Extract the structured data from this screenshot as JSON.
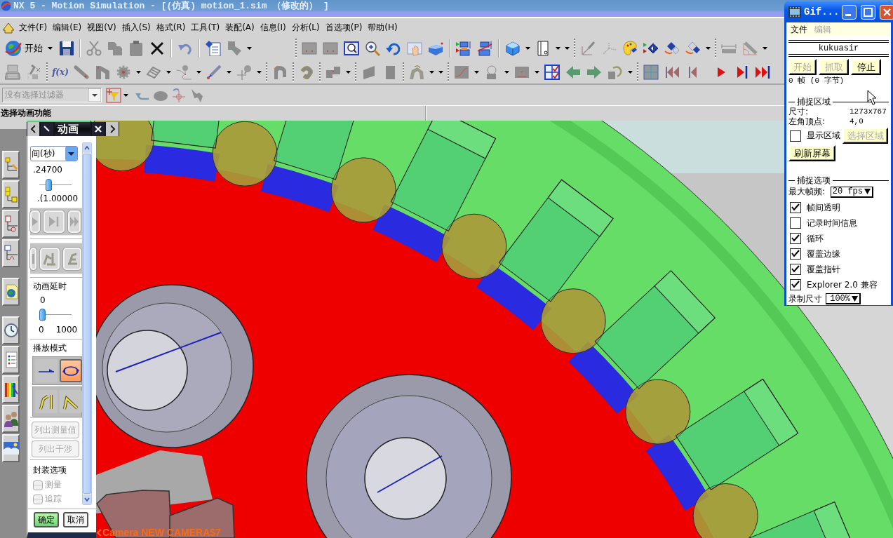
{
  "title_bar": {
    "title": "NX 5 - Motion Simulation - [(仿真) motion_1.sim （修改的） ]"
  },
  "menu_bar": {
    "items": [
      "文件(F)",
      "编辑(E)",
      "视图(V)",
      "插入(S)",
      "格式(R)",
      "工具(T)",
      "装配(A)",
      "信息(I)",
      "分析(L)",
      "首选项(P)",
      "帮助(H)"
    ]
  },
  "toolbar": {
    "start_button": "开始",
    "function_button": "f(x)"
  },
  "selection_bar": {
    "filter": {
      "value": "没有选择过滤器",
      "disabled": true
    }
  },
  "cue_line": {
    "prompt": "选择动画功能"
  },
  "animation_dialog": {
    "title": "动画",
    "time_unit": "间(秒)",
    "time_value": ".24700",
    "time_slider": {
      "level": 0.247
    },
    "time_range": ".(1.00000",
    "delay_label": "动画延时",
    "delay_value": "0",
    "delay_slider": {
      "level": 0
    },
    "delay_min": "0",
    "delay_max": "1000",
    "play_mode_label": "播放模式",
    "play_modes": [
      {
        "kind": "once",
        "selected": false
      },
      {
        "kind": "loop",
        "selected": true
      }
    ],
    "trace_modes": [
      {
        "kind": "upright",
        "selected": false
      },
      {
        "kind": "folded",
        "selected": false
      }
    ],
    "list_buttons": [
      {
        "label": "列出测量值",
        "disabled": true
      },
      {
        "label": "列出干涉",
        "disabled": true
      }
    ],
    "package_label": "封装选项",
    "package_options": [
      {
        "label": "测量",
        "checked": false,
        "disabled": true
      },
      {
        "label": "追踪",
        "checked": false,
        "disabled": true
      }
    ],
    "ok_button": "确定",
    "cancel_button": "取消"
  },
  "viewport": {
    "camera_label": "Camera NEW CAMERA$7"
  },
  "gif_recorder": {
    "title": "Gif...",
    "menu": [
      {
        "label": "文件",
        "disabled": false
      },
      {
        "label": "编辑",
        "disabled": true
      }
    ],
    "user": "kukuasir",
    "buttons": [
      {
        "label": "开始",
        "disabled": true
      },
      {
        "label": "抓取",
        "disabled": true
      },
      {
        "label": "停止",
        "disabled": false
      }
    ],
    "frame_info": "0 帧 (0 字节)",
    "capture_area": {
      "heading": "捕捉区域",
      "fields": [
        {
          "label": "尺寸:",
          "value": "1273x767"
        },
        {
          "label": "左角顶点:",
          "value": "4,0"
        }
      ],
      "show_area": {
        "label": "显示区域",
        "checked": false
      },
      "select_button": {
        "label": "选择区域",
        "disabled": true
      },
      "refresh_button": "刷新屏幕"
    },
    "capture_options": {
      "heading": "捕捉选项",
      "fps_label": "最大帧频:",
      "fps": "20 fps",
      "options": [
        {
          "label": "帧间透明",
          "checked": true
        },
        {
          "label": "记录时间信息",
          "checked": false
        },
        {
          "label": "循环",
          "checked": true
        },
        {
          "label": "覆盖边缘",
          "checked": true
        },
        {
          "label": "覆盖指针",
          "checked": true
        },
        {
          "label": "Explorer 2.0 兼容",
          "checked": true
        }
      ],
      "size_label": "录制尺寸",
      "size": "100%"
    }
  }
}
